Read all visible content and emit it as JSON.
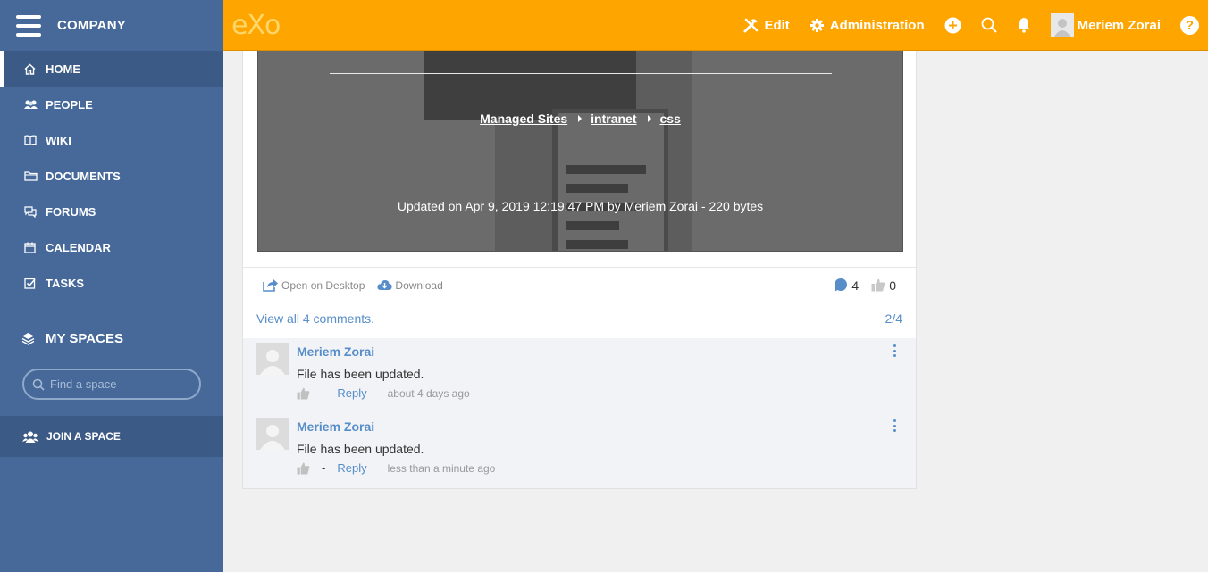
{
  "sidebar": {
    "company": "COMPANY",
    "nav": [
      {
        "label": "HOME",
        "icon": "home-icon"
      },
      {
        "label": "PEOPLE",
        "icon": "people-icon"
      },
      {
        "label": "WIKI",
        "icon": "book-icon"
      },
      {
        "label": "DOCUMENTS",
        "icon": "folder-icon"
      },
      {
        "label": "FORUMS",
        "icon": "forum-icon"
      },
      {
        "label": "CALENDAR",
        "icon": "calendar-icon"
      },
      {
        "label": "TASKS",
        "icon": "checkbox-icon"
      }
    ],
    "my_spaces": "MY SPACES",
    "search_placeholder": "Find a space",
    "join": "JOIN A SPACE"
  },
  "topbar": {
    "logo": "eXo",
    "edit": "Edit",
    "administration": "Administration",
    "user": "Meriem Zorai",
    "help": "?"
  },
  "preview": {
    "crumbs": [
      "Managed Sites",
      "intranet",
      "css"
    ],
    "updated": "Updated on Apr 9, 2019 12:19:47 PM by Meriem Zorai - 220 bytes"
  },
  "actions": {
    "open_desktop": "Open on Desktop",
    "download": "Download",
    "comment_count": "4",
    "like_count": "0"
  },
  "comments_header": {
    "view_all": "View all 4 comments.",
    "pager": "2/4"
  },
  "comments": [
    {
      "author": "Meriem Zorai",
      "text": "File has been updated.",
      "dash": "-",
      "reply": "Reply",
      "time": "about 4 days ago"
    },
    {
      "author": "Meriem Zorai",
      "text": "File has been updated.",
      "dash": "-",
      "reply": "Reply",
      "time": "less than a minute ago"
    }
  ],
  "colors": {
    "sidebar": "#46699a",
    "topbar": "#fea500",
    "link": "#578dc9"
  }
}
